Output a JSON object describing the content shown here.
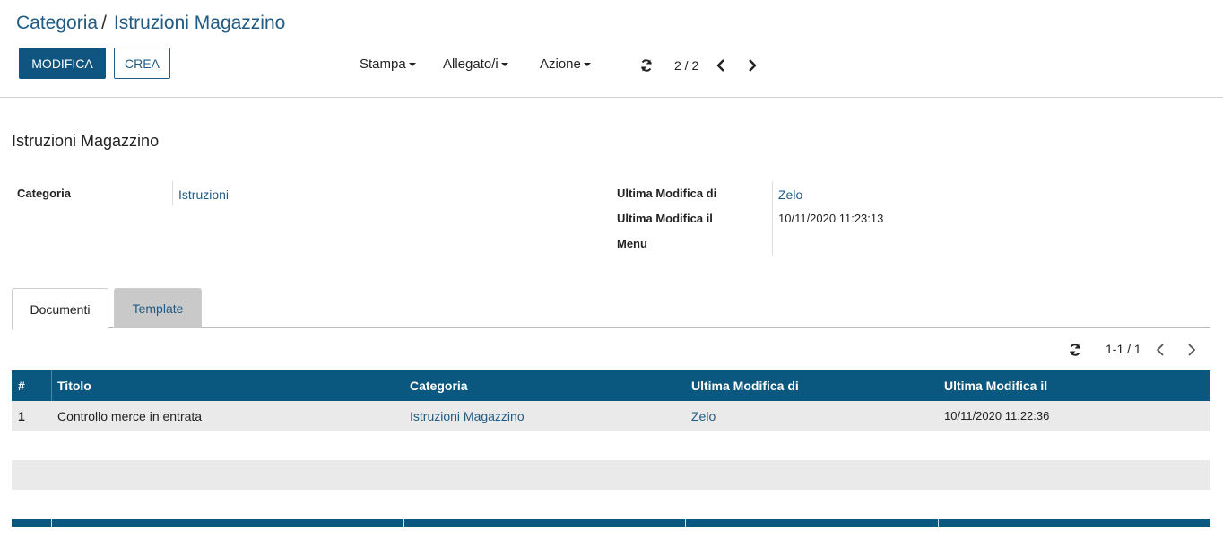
{
  "breadcrumb": {
    "parent": "Categoria",
    "separator": "/",
    "current": "Istruzioni Magazzino"
  },
  "toolbar": {
    "edit_label": "MODIFICA",
    "create_label": "CREA",
    "print_label": "Stampa",
    "attachments_label": "Allegato/i",
    "action_label": "Azione",
    "pager": "2 / 2"
  },
  "record": {
    "title": "Istruzioni Magazzino",
    "category_label": "Categoria",
    "category_value": "Istruzioni",
    "last_modified_by_label": "Ultima Modifica di",
    "last_modified_by_value": "Zelo",
    "last_modified_on_label": "Ultima Modifica il",
    "last_modified_on_value": "10/11/2020 11:23:13",
    "menu_label": "Menu"
  },
  "tabs": [
    {
      "label": "Documenti",
      "active": true
    },
    {
      "label": "Template",
      "active": false
    }
  ],
  "list": {
    "pager": "1-1 / 1",
    "columns": [
      "#",
      "Titolo",
      "Categoria",
      "Ultima Modifica di",
      "Ultima Modifica il"
    ],
    "rows": [
      {
        "num": "1",
        "title": "Controllo merce in entrata",
        "category": "Istruzioni Magazzino",
        "modified_by": "Zelo",
        "modified_on": "10/11/2020 11:22:36"
      }
    ]
  },
  "colors": {
    "primary": "#0f5580",
    "link": "#1f5b84",
    "table_header": "#0a587f"
  }
}
